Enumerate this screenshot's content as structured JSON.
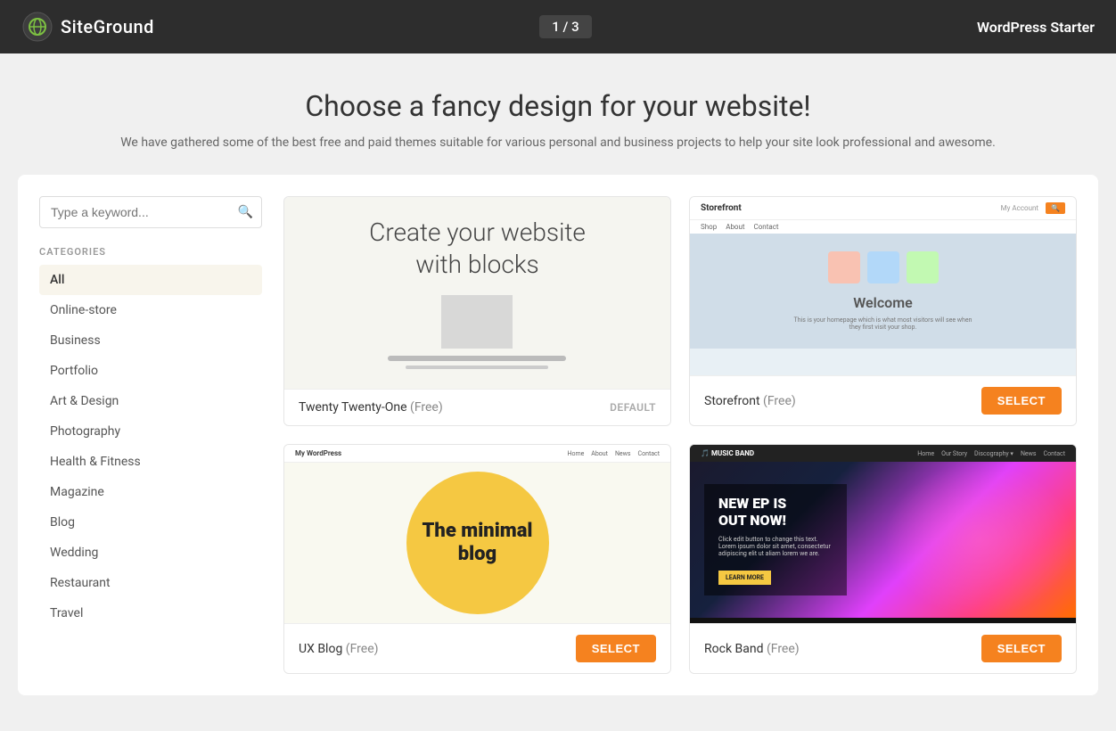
{
  "header": {
    "logo_text": "SiteGround",
    "progress": "1 / 3",
    "app_name": "WordPress Starter"
  },
  "page": {
    "title": "Choose a fancy design for your website!",
    "subtitle": "We have gathered some of the best free and paid themes suitable for various personal and business projects to help your site look professional and awesome."
  },
  "search": {
    "placeholder": "Type a keyword..."
  },
  "categories": {
    "label": "CATEGORIES",
    "items": [
      {
        "id": "all",
        "label": "All",
        "active": true
      },
      {
        "id": "online-store",
        "label": "Online-store",
        "active": false
      },
      {
        "id": "business",
        "label": "Business",
        "active": false
      },
      {
        "id": "portfolio",
        "label": "Portfolio",
        "active": false
      },
      {
        "id": "art-design",
        "label": "Art & Design",
        "active": false
      },
      {
        "id": "photography",
        "label": "Photography",
        "active": false
      },
      {
        "id": "health-fitness",
        "label": "Health & Fitness",
        "active": false
      },
      {
        "id": "magazine",
        "label": "Magazine",
        "active": false
      },
      {
        "id": "blog",
        "label": "Blog",
        "active": false
      },
      {
        "id": "wedding",
        "label": "Wedding",
        "active": false
      },
      {
        "id": "restaurant",
        "label": "Restaurant",
        "active": false
      },
      {
        "id": "travel",
        "label": "Travel",
        "active": false
      }
    ]
  },
  "themes": [
    {
      "id": "twenty-twenty-one",
      "name": "Twenty Twenty-One",
      "price_label": "(Free)",
      "action": "DEFAULT",
      "action_type": "default"
    },
    {
      "id": "storefront",
      "name": "Storefront",
      "price_label": "(Free)",
      "action": "SELECT",
      "action_type": "select"
    },
    {
      "id": "ux-blog",
      "name": "UX Blog",
      "price_label": "(Free)",
      "action": "SELECT",
      "action_type": "select"
    },
    {
      "id": "rock-band",
      "name": "Rock Band",
      "price_label": "(Free)",
      "action": "SELECT",
      "action_type": "select"
    }
  ],
  "icons": {
    "search": "🔍"
  },
  "colors": {
    "accent": "#f5821f",
    "header_bg": "#2d2d2d",
    "progress_bg": "#444444"
  }
}
